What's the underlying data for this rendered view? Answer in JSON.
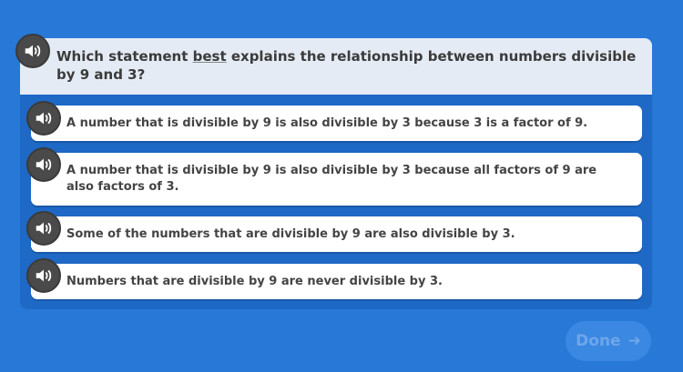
{
  "question": {
    "text_before": "Which statement ",
    "emphasis": "best",
    "text_after": " explains the relationship between numbers divisible by 9 and 3?"
  },
  "choices": [
    {
      "label": "A number that is divisible by 9 is also divisible by 3 because 3 is a factor of 9."
    },
    {
      "label": "A number that is divisible by 9 is also divisible by 3 because all factors of 9 are also factors of 3."
    },
    {
      "label": "Some of the numbers that are divisible by 9 are also divisible by 3."
    },
    {
      "label": "Numbers that are divisible by 9 are never divisible by 3."
    }
  ],
  "done_button": {
    "label": "Done",
    "icon": "arrow-right-icon"
  },
  "icons": {
    "audio": "speaker-icon"
  },
  "colors": {
    "background": "#2878d8",
    "panel": "#1e68c6",
    "question_bg": "#e4ebf4",
    "speaker": "#4a4a4a"
  }
}
